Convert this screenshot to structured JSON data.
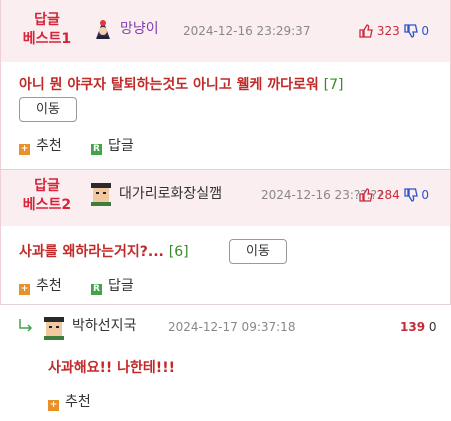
{
  "comments": [
    {
      "badge": "답글\n베스트1",
      "nickname": "망냥이",
      "date": "2024-12-16 23:29:37",
      "up": "323",
      "down": "0",
      "text": "아니 뭔 야쿠자 탈퇴하는것도 아니고 웰케 까다로워",
      "reply_count": "[7]",
      "move_label": "이동",
      "recommend_label": "추천",
      "reply_label": "답글",
      "colors": {
        "nickname": "#7a3fae"
      }
    },
    {
      "badge": "답글\n베스트2",
      "nickname": "대가리로화장실깸",
      "date": "2024-12-16 23:??:??",
      "up": "284",
      "down": "0",
      "text": "사과를 왜하라는거지?...",
      "reply_count": "[6]",
      "move_label": "이동",
      "recommend_label": "추천",
      "reply_label": "답글",
      "colors": {
        "nickname": "#333333"
      }
    },
    {
      "nickname": "박하선지국",
      "date": "2024-12-17 09:37:18",
      "up": "139",
      "down": "0",
      "text": "사과해요!! 나한테!!!",
      "recommend_label": "추천"
    }
  ],
  "icons": {
    "thumb_up": "thumb-up-icon",
    "thumb_down": "thumb-down-icon",
    "reply_arrow": "reply-arrow-icon"
  }
}
